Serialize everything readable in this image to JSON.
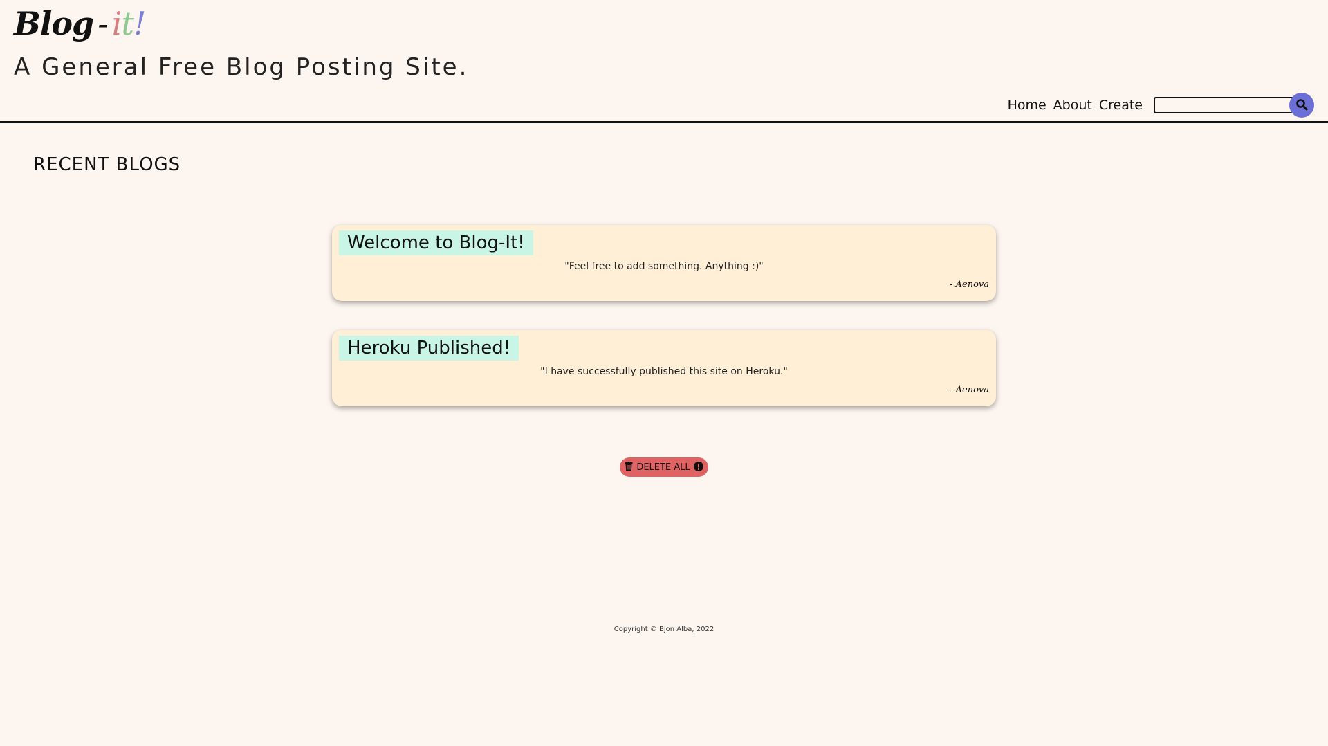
{
  "header": {
    "brand": {
      "main": "Blog",
      "separator": "-",
      "accent_i": "i",
      "accent_t": "t",
      "accent_bang": "!"
    },
    "tagline": "A General Free Blog Posting Site."
  },
  "nav": {
    "items": [
      {
        "label": "Home"
      },
      {
        "label": "About"
      },
      {
        "label": "Create"
      }
    ],
    "search": {
      "value": "",
      "placeholder": "",
      "button_icon": "search-icon"
    }
  },
  "main": {
    "section_title": "RECENT BLOGS",
    "blogs": [
      {
        "title": "Welcome to Blog-It!",
        "text": "\"Feel free to add something. Anything :)\"",
        "author": "- Aenova"
      },
      {
        "title": "Heroku Published!",
        "text": "\"I have successfully published this site on Heroku.\"",
        "author": "- Aenova"
      }
    ],
    "delete_all": {
      "label": "DELETE ALL",
      "icon_left": "trash-icon",
      "icon_right": "exclamation-circle-icon"
    }
  },
  "footer": {
    "copyright": "Copyright © Bjon Alba, 2022"
  },
  "colors": {
    "background": "#fdf6f0",
    "card_background": "#ffefd6",
    "title_highlight": "#c9f5e6",
    "search_button": "#6c6fd6",
    "delete_button": "#e06262",
    "brand_i": "#d77f7f",
    "brand_t": "#8fc98f",
    "brand_bang": "#7c7fd6"
  }
}
